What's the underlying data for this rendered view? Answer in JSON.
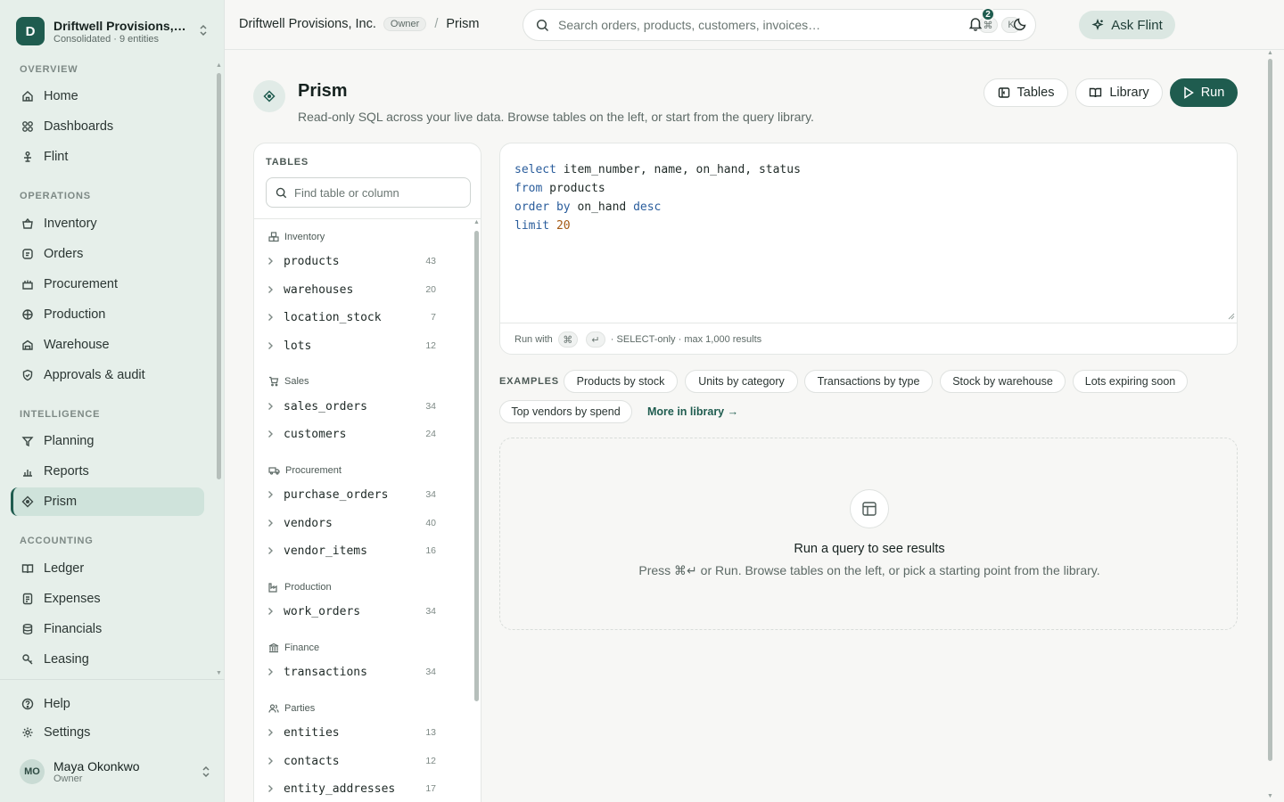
{
  "org": {
    "initial": "D",
    "name": "Driftwell Provisions, Inc.",
    "subtitle": "Consolidated · 9 entities"
  },
  "nav": {
    "sections": [
      {
        "label": "OVERVIEW"
      },
      {
        "label": "OPERATIONS"
      },
      {
        "label": "INTELLIGENCE"
      },
      {
        "label": "ACCOUNTING"
      }
    ],
    "items": [
      {
        "label": "Home",
        "icon": "home-icon"
      },
      {
        "label": "Dashboards",
        "icon": "dashboards-icon"
      },
      {
        "label": "Flint",
        "icon": "flint-icon"
      },
      {
        "label": "Inventory",
        "icon": "inventory-icon"
      },
      {
        "label": "Orders",
        "icon": "orders-icon"
      },
      {
        "label": "Procurement",
        "icon": "procurement-icon"
      },
      {
        "label": "Production",
        "icon": "production-icon"
      },
      {
        "label": "Warehouse",
        "icon": "warehouse-icon"
      },
      {
        "label": "Approvals & audit",
        "icon": "shield-icon"
      },
      {
        "label": "Planning",
        "icon": "planning-icon"
      },
      {
        "label": "Reports",
        "icon": "reports-icon"
      },
      {
        "label": "Prism",
        "icon": "prism-icon",
        "active": true
      },
      {
        "label": "Ledger",
        "icon": "ledger-icon"
      },
      {
        "label": "Expenses",
        "icon": "expenses-icon"
      },
      {
        "label": "Financials",
        "icon": "financials-icon"
      },
      {
        "label": "Leasing",
        "icon": "leasing-icon"
      }
    ],
    "footer": [
      {
        "label": "Help",
        "icon": "help-icon"
      },
      {
        "label": "Settings",
        "icon": "gear-icon"
      }
    ]
  },
  "user": {
    "initials": "MO",
    "name": "Maya Okonkwo",
    "role": "Owner"
  },
  "topbar": {
    "org_name": "Driftwell Provisions, Inc.",
    "role_badge": "Owner",
    "separator": "/",
    "page": "Prism",
    "search_placeholder": "Search orders, products, customers, invoices…",
    "search_kbd": [
      "⌘",
      "K"
    ],
    "ask_label": "Ask Flint",
    "notifications_count": "2"
  },
  "page": {
    "title": "Prism",
    "subtitle": "Read-only SQL across your live data. Browse tables on the left, or start from the query library.",
    "buttons": {
      "tables": "Tables",
      "library": "Library",
      "run": "Run"
    }
  },
  "tables_panel": {
    "title": "TABLES",
    "search_placeholder": "Find table or column",
    "groups": [
      {
        "name": "Inventory",
        "tables": [
          {
            "name": "products",
            "count": "43"
          },
          {
            "name": "warehouses",
            "count": "20"
          },
          {
            "name": "location_stock",
            "count": "7"
          },
          {
            "name": "lots",
            "count": "12"
          }
        ]
      },
      {
        "name": "Sales",
        "tables": [
          {
            "name": "sales_orders",
            "count": "34"
          },
          {
            "name": "customers",
            "count": "24"
          }
        ]
      },
      {
        "name": "Procurement",
        "tables": [
          {
            "name": "purchase_orders",
            "count": "34"
          },
          {
            "name": "vendors",
            "count": "40"
          },
          {
            "name": "vendor_items",
            "count": "16"
          }
        ]
      },
      {
        "name": "Production",
        "tables": [
          {
            "name": "work_orders",
            "count": "34"
          }
        ]
      },
      {
        "name": "Finance",
        "tables": [
          {
            "name": "transactions",
            "count": "34"
          }
        ]
      },
      {
        "name": "Parties",
        "tables": [
          {
            "name": "entities",
            "count": "13"
          },
          {
            "name": "contacts",
            "count": "12"
          },
          {
            "name": "entity_addresses",
            "count": "17"
          }
        ]
      }
    ]
  },
  "editor": {
    "query": [
      [
        {
          "t": "select",
          "c": "kw"
        },
        {
          "t": " item_number, name, on_hand, status",
          "c": ""
        }
      ],
      [
        {
          "t": "from",
          "c": "kw"
        },
        {
          "t": " products",
          "c": ""
        }
      ],
      [
        {
          "t": "order by",
          "c": "kw"
        },
        {
          "t": " on_hand ",
          "c": ""
        },
        {
          "t": "desc",
          "c": "kw"
        }
      ],
      [
        {
          "t": "limit",
          "c": "kw"
        },
        {
          "t": " ",
          "c": ""
        },
        {
          "t": "20",
          "c": "num"
        }
      ]
    ],
    "footer_prefix": "Run with",
    "footer_kbd": [
      "⌘",
      "↵"
    ],
    "footer_suffix": "· SELECT-only · max 1,000 results"
  },
  "examples": {
    "label": "EXAMPLES",
    "chips": [
      "Products by stock",
      "Units by category",
      "Transactions by type",
      "Stock by warehouse",
      "Lots expiring soon",
      "Top vendors by spend"
    ],
    "more_link": "More in library →"
  },
  "results": {
    "title": "Run a query to see results",
    "subtitle": "Press ⌘↵ or Run. Browse tables on the left, or pick a starting point from the library."
  },
  "colors": {
    "accent": "#1f5c4f",
    "sidebar_bg": "#e6efea",
    "active_bg": "#cfe3db"
  }
}
